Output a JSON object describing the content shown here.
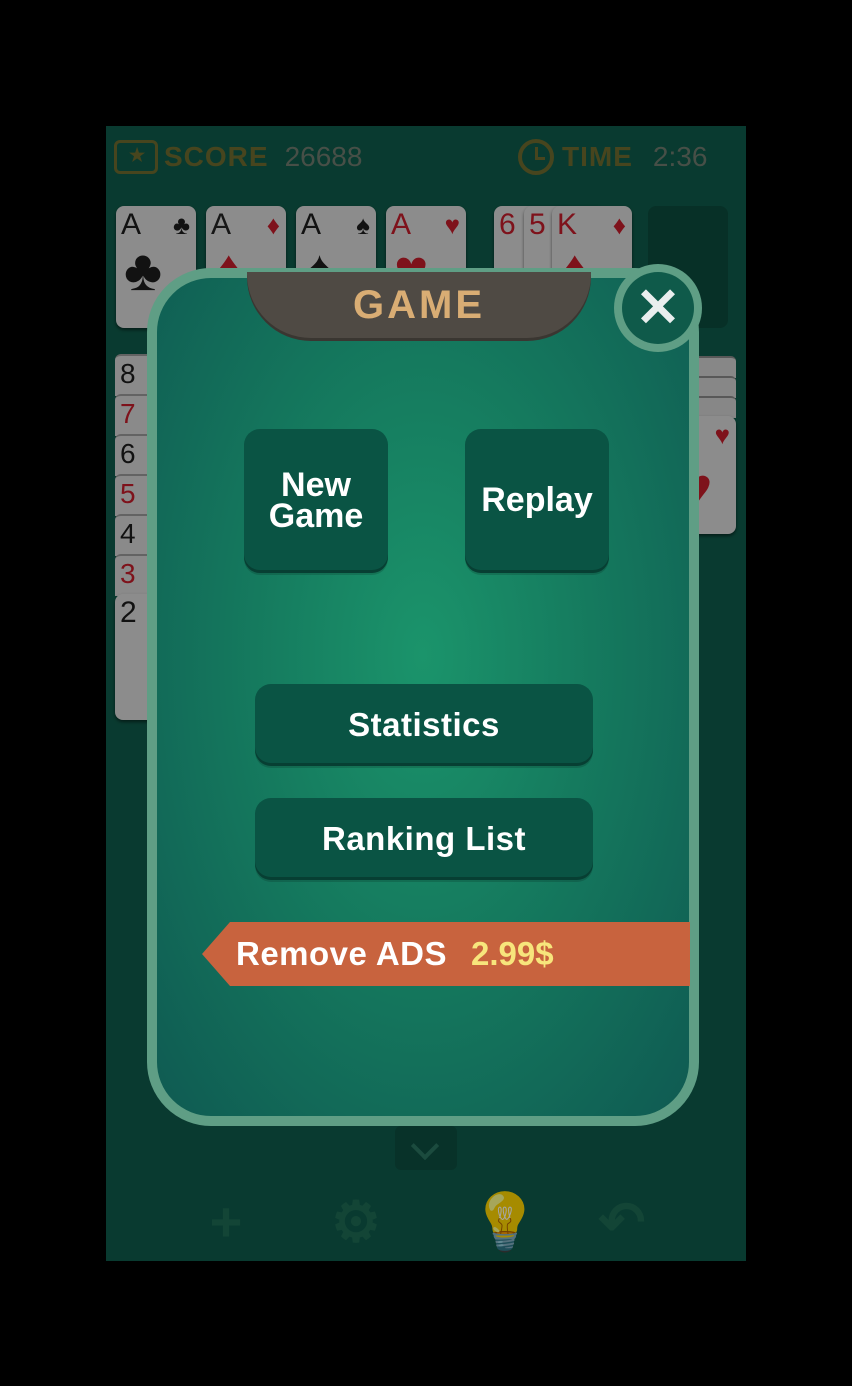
{
  "header": {
    "score_label": "SCORE",
    "score_value": "26688",
    "time_label": "TIME",
    "time_value": "2:36"
  },
  "foundations": [
    {
      "rank": "A",
      "suit": "♣",
      "color": "black"
    },
    {
      "rank": "A",
      "suit": "♦",
      "color": "red"
    },
    {
      "rank": "A",
      "suit": "♠",
      "color": "black"
    },
    {
      "rank": "A",
      "suit": "♥",
      "color": "red"
    }
  ],
  "waste": [
    {
      "rank": "6",
      "color": "red"
    },
    {
      "rank": "5",
      "color": "red"
    },
    {
      "rank": "K",
      "suit": "♦",
      "color": "red"
    }
  ],
  "tableau_column": [
    "8",
    "7",
    "6",
    "5",
    "4",
    "3",
    "2"
  ],
  "right_card": {
    "suit": "♥",
    "color": "red"
  },
  "toolbar": {
    "icons": [
      "plus-icon",
      "gear-icon",
      "lightbulb-icon",
      "undo-icon"
    ]
  },
  "dialog": {
    "title": "GAME",
    "close_glyph": "✕",
    "new_game_label_line1": "New",
    "new_game_label_line2": "Game",
    "replay_label": "Replay",
    "statistics_label": "Statistics",
    "ranking_label": "Ranking List",
    "remove_ads_label": "Remove ADS",
    "remove_ads_price": "2.99$"
  },
  "colors": {
    "table_green": "#0f5a4a",
    "dialog_border": "#5f9e85",
    "title_text": "#d9ad74",
    "ads_ribbon": "#c8633e",
    "price_text": "#f7e57c"
  }
}
